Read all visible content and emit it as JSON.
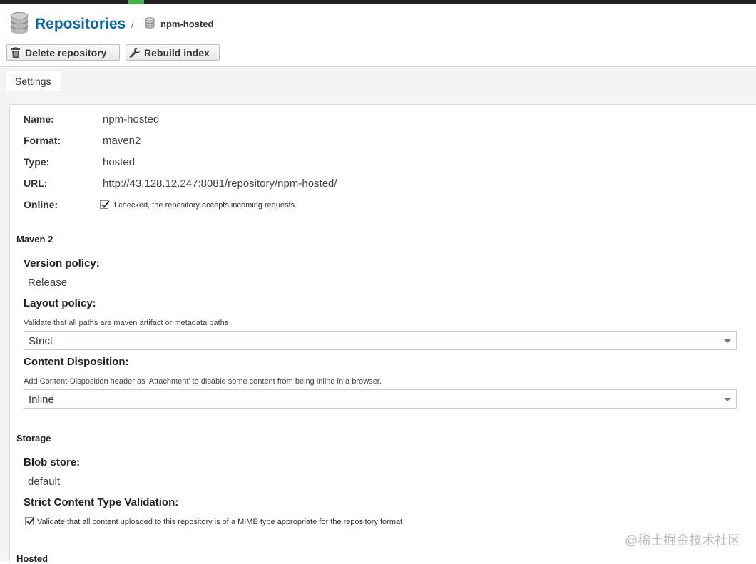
{
  "header": {
    "title": "Repositories",
    "separator": "/",
    "current": "npm-hosted"
  },
  "toolbar": {
    "delete_label": "Delete repository",
    "rebuild_label": "Rebuild index"
  },
  "tabs": [
    {
      "label": "Settings",
      "active": true
    }
  ],
  "summary": {
    "name_label": "Name:",
    "name_value": "npm-hosted",
    "format_label": "Format:",
    "format_value": "maven2",
    "type_label": "Type:",
    "type_value": "hosted",
    "url_label": "URL:",
    "url_value": "http://43.128.12.247:8081/repository/npm-hosted/",
    "online_label": "Online:",
    "online_checked": true,
    "online_help": "If checked, the repository accepts incoming requests"
  },
  "maven": {
    "section_title": "Maven 2",
    "version_policy_label": "Version policy:",
    "version_policy_value": "Release",
    "layout_policy_label": "Layout policy:",
    "layout_policy_help": "Validate that all paths are maven artifact or metadata paths",
    "layout_policy_value": "Strict",
    "content_disposition_label": "Content Disposition:",
    "content_disposition_help": "Add Content-Disposition header as 'Attachment' to disable some content from being inline in a browser.",
    "content_disposition_value": "Inline"
  },
  "storage": {
    "section_title": "Storage",
    "blob_store_label": "Blob store:",
    "blob_store_value": "default",
    "strict_label": "Strict Content Type Validation:",
    "strict_checked": true,
    "strict_help": "Validate that all content uploaded to this repository is of a MIME type appropriate for the repository format"
  },
  "hosted": {
    "section_title": "Hosted"
  },
  "watermark": "@稀土掘金技术社区",
  "colors": {
    "title": "#0a6aa8",
    "topbar": "#222222",
    "topbar_accent": "#4cae4c"
  },
  "icons": {
    "header": "database-icon",
    "breadcrumb": "database-icon",
    "delete": "trash-icon",
    "rebuild": "wrench-icon"
  }
}
